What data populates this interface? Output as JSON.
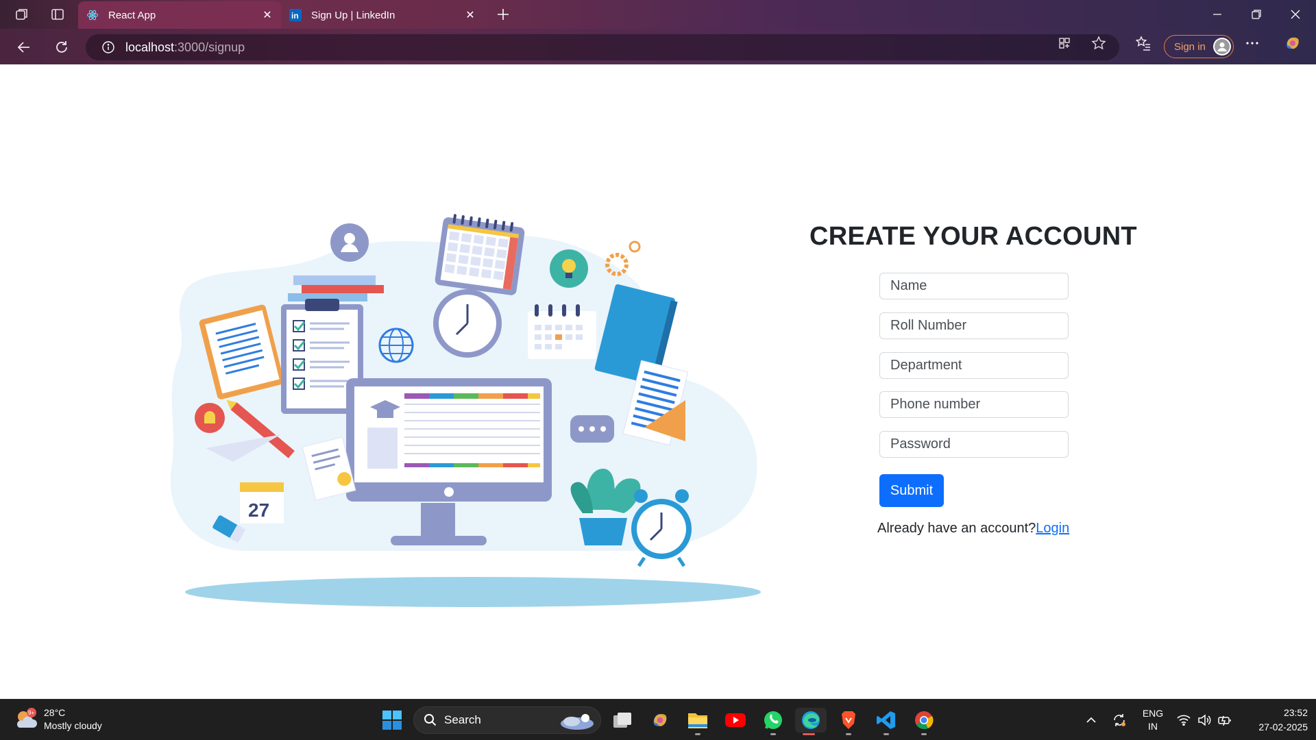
{
  "browser": {
    "tabs": [
      {
        "title": "React App",
        "favicon": "react-logo-icon",
        "active": true
      },
      {
        "title": "Sign Up | LinkedIn",
        "favicon": "linkedin-logo-icon",
        "active": false
      }
    ],
    "address": {
      "host": "localhost",
      "path": ":3000/signup"
    },
    "signin_label": "Sign in"
  },
  "form": {
    "title": "CREATE YOUR ACCOUNT",
    "fields": {
      "name": "Name",
      "roll": "Roll Number",
      "department": "Department",
      "phone": "Phone number",
      "password": "Password"
    },
    "submit_label": "Submit",
    "login_prompt": "Already have an account?",
    "login_link": "Login"
  },
  "illustration": {
    "calendar_day": "27"
  },
  "taskbar": {
    "weather": {
      "temp": "28°C",
      "condition": "Mostly cloudy",
      "badge": "9+"
    },
    "search_label": "Search",
    "language": {
      "line1": "ENG",
      "line2": "IN"
    },
    "clock": {
      "time": "23:52",
      "date": "27-02-2025"
    }
  },
  "colors": {
    "primary": "#0d6efd",
    "chrome": "#6e2e4d",
    "taskbar": "#1f1f1f"
  }
}
